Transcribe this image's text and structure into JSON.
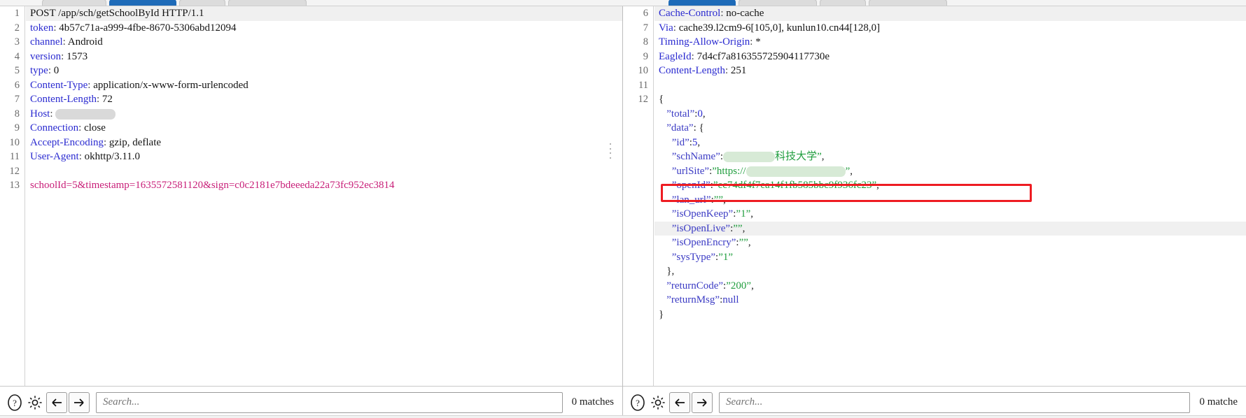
{
  "window": {
    "tabs_left": [
      "",
      "",
      "",
      ""
    ],
    "tabs_right": [
      "",
      "",
      ""
    ]
  },
  "request_panel": {
    "name": "HTTP request viewer",
    "start_line": 1,
    "lines": [
      {
        "n": "1",
        "type": "request-line",
        "method": "POST",
        "path": "/app/sch/getSchoolById",
        "version": "HTTP/1.1"
      },
      {
        "n": "2",
        "type": "header",
        "name": "token",
        "value": "4b57c71a-a999-4fbe-8670-5306abd12094"
      },
      {
        "n": "3",
        "type": "header",
        "name": "channel",
        "value": "Android"
      },
      {
        "n": "4",
        "type": "header",
        "name": "version",
        "value": "1573"
      },
      {
        "n": "5",
        "type": "header",
        "name": "type",
        "value": "0"
      },
      {
        "n": "6",
        "type": "header",
        "name": "Content-Type",
        "value": "application/x-www-form-urlencoded"
      },
      {
        "n": "7",
        "type": "header",
        "name": "Content-Length",
        "value": "72"
      },
      {
        "n": "8",
        "type": "header",
        "name": "Host",
        "value": "",
        "redacted": "gray"
      },
      {
        "n": "9",
        "type": "header",
        "name": "Connection",
        "value": "close"
      },
      {
        "n": "10",
        "type": "header",
        "name": "Accept-Encoding",
        "value": "gzip, deflate"
      },
      {
        "n": "11",
        "type": "header",
        "name": "User-Agent",
        "value": "okhttp/3.11.0"
      },
      {
        "n": "12",
        "type": "blank",
        "value": ""
      },
      {
        "n": "13",
        "type": "body",
        "value": "schoolId=5&timestamp=1635572581120&sign=c0c2181e7bdeeeda22a73fc952ec3814"
      }
    ],
    "toolbar": {
      "help_icon": "question-circle-icon",
      "settings_icon": "gear-icon",
      "prev_icon": "arrow-left-icon",
      "next_icon": "arrow-right-icon",
      "search_value": "",
      "search_placeholder": "Search...",
      "matches": "0 matches"
    }
  },
  "response_panel": {
    "name": "HTTP response viewer",
    "lines": [
      {
        "n": "6",
        "type": "header",
        "name": "Cache-Control",
        "value": "no-cache"
      },
      {
        "n": "7",
        "type": "header",
        "name": "Via",
        "value": "cache39.l2cm9-6[105,0], kunlun10.cn44[128,0]"
      },
      {
        "n": "8",
        "type": "header",
        "name": "Timing-Allow-Origin",
        "value": "*"
      },
      {
        "n": "9",
        "type": "header",
        "name": "EagleId",
        "value": "7d4cf7a816355725904117730e"
      },
      {
        "n": "10",
        "type": "header",
        "name": "Content-Length",
        "value": "251"
      },
      {
        "n": "11",
        "type": "blank",
        "value": ""
      },
      {
        "n": "12",
        "type": "json-open",
        "value": "{"
      }
    ],
    "json_body": {
      "total": 0,
      "data": {
        "id": 5,
        "schName": "科技大学",
        "schName_redacted": true,
        "urlSite": "https://",
        "urlSite_redacted": true,
        "openId": "ec74df4f7ea14f1fb585bbc9f936fc23",
        "lan_url": "",
        "isOpenKeep": "1",
        "isOpenLive": "",
        "isOpenEncry": "",
        "sysType": "1"
      },
      "returnCode": "200",
      "returnMsg": null
    },
    "highlight": {
      "name": "openid-highlight-box",
      "color": "#ee1c22",
      "target_key": "openId"
    },
    "toolbar": {
      "help_icon": "question-circle-icon",
      "settings_icon": "gear-icon",
      "prev_icon": "arrow-left-icon",
      "next_icon": "arrow-right-icon",
      "search_value": "",
      "search_placeholder": "Search...",
      "matches": "0 matche"
    }
  },
  "colors": {
    "header_name": "#2a2ad0",
    "json_key": "#3b3bc4",
    "json_string": "#1f9d3d",
    "json_number": "#2a2ad0",
    "body_text": "#c81e78",
    "highlight": "#ee1c22",
    "tab_active": "#1e6bb8"
  }
}
